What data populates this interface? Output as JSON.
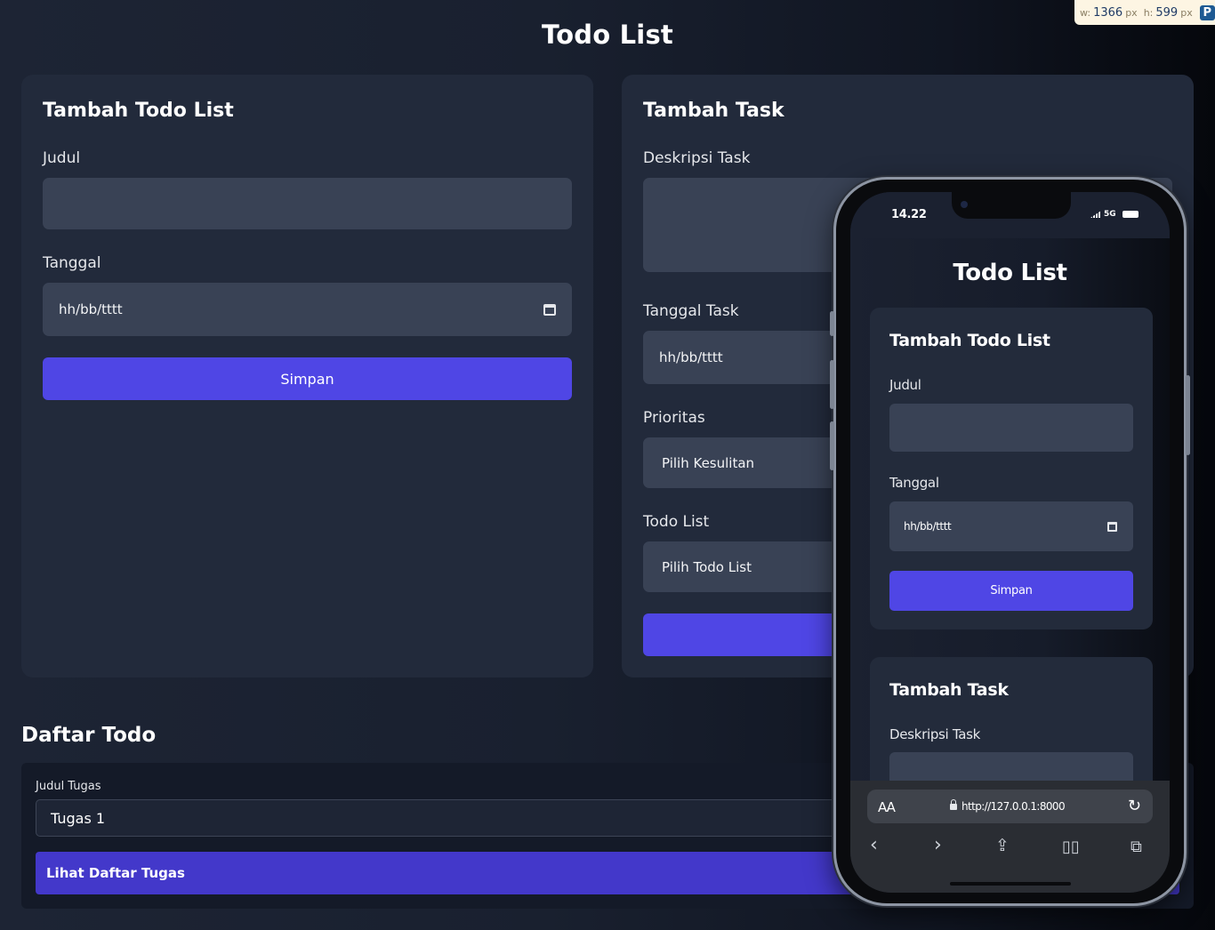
{
  "page": {
    "title": "Todo List"
  },
  "add_todo": {
    "heading": "Tambah Todo List",
    "judul_label": "Judul",
    "judul_value": "",
    "tanggal_label": "Tanggal",
    "tanggal_placeholder": "hh/bb/tttt",
    "submit_label": "Simpan"
  },
  "add_task": {
    "heading": "Tambah Task",
    "desc_label": "Deskripsi Task",
    "desc_value": "",
    "date_label": "Tanggal Task",
    "date_placeholder": "hh/bb/tttt",
    "priority_label": "Prioritas",
    "priority_selected": "Pilih Kesulitan",
    "todolist_label": "Todo List",
    "todolist_selected": "Pilih Todo List",
    "submit_label": ""
  },
  "todo_list": {
    "heading": "Daftar Todo",
    "select_label": "Judul Tugas",
    "select_value": "Tugas 1",
    "view_button": "Lihat Daftar Tugas"
  },
  "extension_badge": {
    "w_label": "w:",
    "w_value": "1366",
    "h_label": "h:",
    "h_value": "599",
    "unit": "px",
    "icon": "P"
  },
  "mobile": {
    "status_time": "14.22",
    "network": "5G",
    "title": "Todo List",
    "add_todo_heading": "Tambah Todo List",
    "judul_label": "Judul",
    "tanggal_label": "Tanggal",
    "tanggal_placeholder": "hh/bb/tttt",
    "submit_label": "Simpan",
    "add_task_heading": "Tambah Task",
    "desc_label": "Deskripsi Task",
    "browser": {
      "text_size": "AA",
      "url": "http://127.0.0.1:8000"
    }
  },
  "colors": {
    "accent": "#4f46e5",
    "accent_dark": "#4338ca",
    "card": "#222a3b",
    "field": "#394255"
  }
}
